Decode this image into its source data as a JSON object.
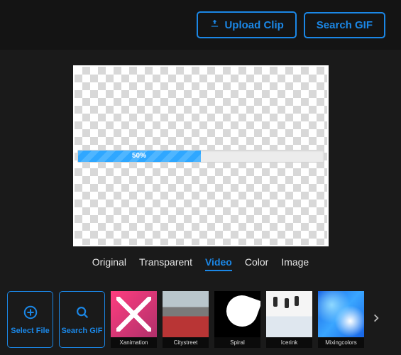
{
  "header": {
    "upload_label": "Upload Clip",
    "search_label": "Search GIF"
  },
  "canvas": {
    "progress_percent": 50,
    "progress_label": "50%"
  },
  "tabs": [
    {
      "label": "Original",
      "active": false
    },
    {
      "label": "Transparent",
      "active": false
    },
    {
      "label": "Video",
      "active": true
    },
    {
      "label": "Color",
      "active": false
    },
    {
      "label": "Image",
      "active": false
    }
  ],
  "tools": {
    "select_file_label": "Select File",
    "search_gif_label": "Search GIF"
  },
  "thumbnails": [
    {
      "label": "Xanimation",
      "visual": "v-xanim"
    },
    {
      "label": "Citystreet",
      "visual": "v-city"
    },
    {
      "label": "Spiral",
      "visual": "v-spiral"
    },
    {
      "label": "Icerink",
      "visual": "v-ice"
    },
    {
      "label": "Mixingcolors",
      "visual": "v-mix"
    }
  ],
  "colors": {
    "accent": "#1b87e6"
  }
}
